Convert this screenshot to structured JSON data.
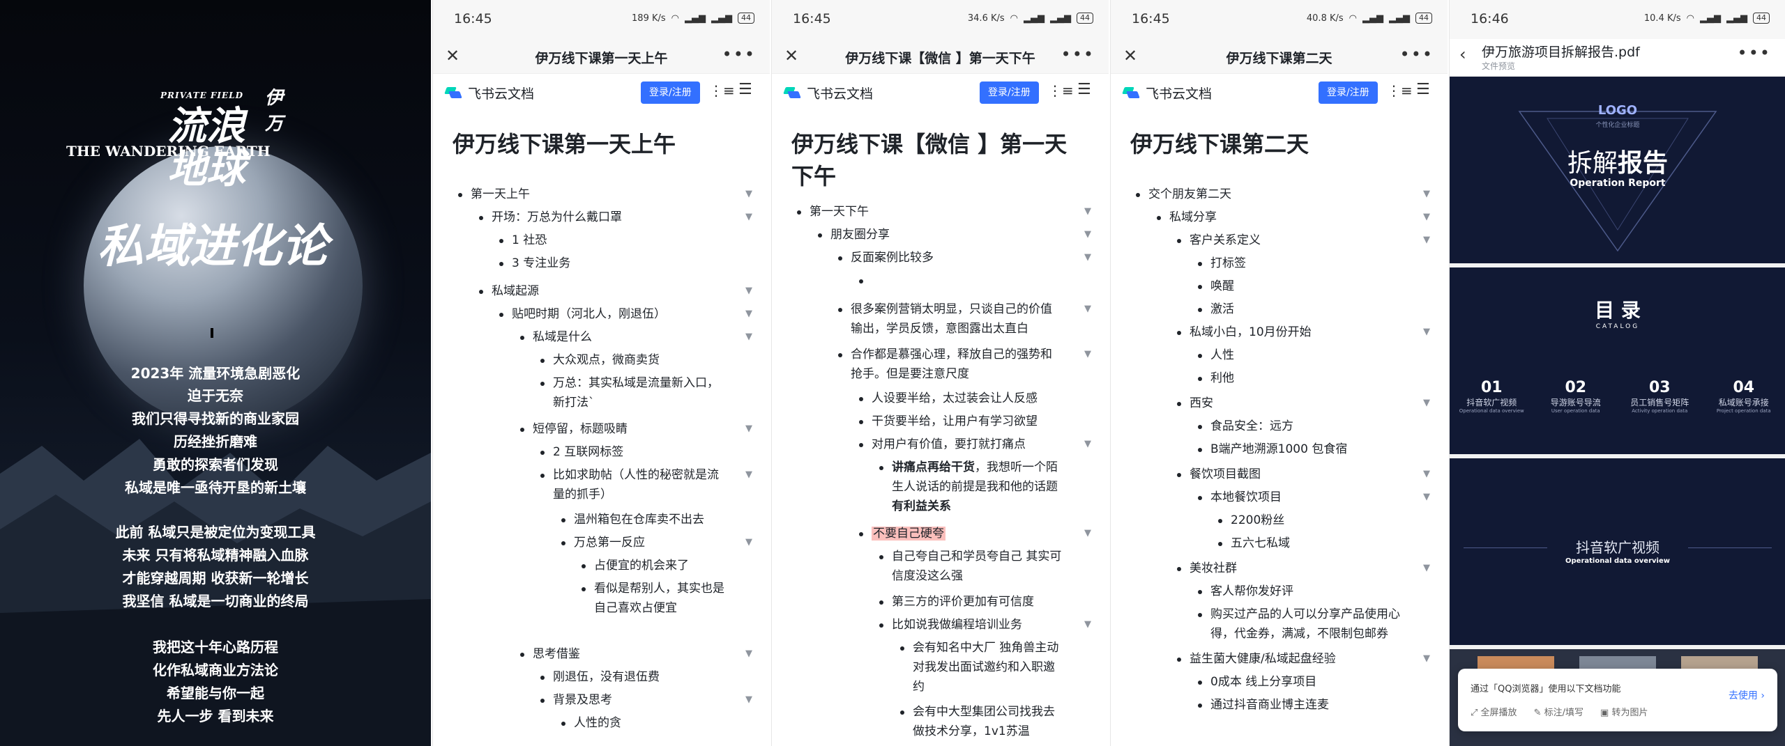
{
  "poster": {
    "en_top": "PRIVATE FIELD",
    "en_title": "THE WANDERING EARTH",
    "cn_title": "流浪地球",
    "brand": "伊万",
    "headline": "私域进化论",
    "lines": [
      "2023年 流量环境急剧恶化",
      "迫于无奈",
      "我们只得寻找新的商业家园",
      "历经挫折磨难",
      "勇敢的探索者们发现",
      "私域是唯一亟待开垦的新土壤",
      "此前 私域只是被定位为变现工具",
      "未来 只有将私域精神融入血脉",
      "才能穿越周期 收获新一轮增长",
      "我坚信 私域是一切商业的终局",
      "我把这十年心路历程",
      "化作私域商业方法论",
      "希望能与你一起",
      "先人一步 看到未来"
    ]
  },
  "common": {
    "brand": "飞书云文档",
    "login": "登录/注册"
  },
  "doc1": {
    "time": "16:45",
    "speed": "189 K/s",
    "battery": "44",
    "title": "伊万线下课第一天上午",
    "rows": [
      "第一天上午",
      "开场：万总为什么戴口罩",
      "1 社恐",
      "3 专注业务",
      "私域起源",
      "贴吧时期（河北人，刚退伍）",
      "私域是什么",
      "大众观点，微商卖货",
      "万总：其实私域是流量新入口，",
      "新打法`",
      "短停留，标题吸睛",
      "2 互联网标签",
      "比如求助帖（人性的秘密就是流",
      "量的抓手）",
      "温州箱包在仓库卖不出去",
      "万总第一反应",
      "占便宜的机会来了",
      "看似是帮别人，其实也是",
      "自己喜欢占便宜",
      "思考借鉴",
      "刚退伍，没有退伍费",
      "背景及思考",
      "人性的贪"
    ]
  },
  "doc2": {
    "time": "16:45",
    "speed": "34.6 K/s",
    "battery": "44",
    "title": "伊万线下课【微信 】第一天下午",
    "title_l1": "伊万线下课【微信 】第一天",
    "title_l2": "下午",
    "rows": [
      "第一天下午",
      "朋友圈分享",
      "反面案例比较多",
      "",
      "很多案例营销太明显，只谈自己的价值",
      "输出，学员反馈，意图露出太直白",
      "合作都是慕强心理，释放自己的强势和",
      "抢手。但是要注意尺度",
      "人设要半给，太过装会让人反感",
      "干货要半给，让用户有学习欲望",
      "对用户有价值，要打就打痛点",
      "讲痛点再给干货",
      "，我想听一个陌",
      "生人说话的前提是我和他的话题",
      "有利益关系",
      "不要自己硬夸",
      "自己夸自己和学员夸自己 其实可",
      "信度没这么强",
      "第三方的评价更加有可信度",
      "比如说我做编程培训业务",
      "会有知名中大厂 独角兽主动",
      "对我发出面试邀约和入职邀",
      "约",
      "会有中大型集团公司找我去",
      "做技术分享，1v1苏温"
    ]
  },
  "doc3": {
    "time": "16:45",
    "speed": "40.8 K/s",
    "battery": "44",
    "title": "伊万线下课第二天",
    "rows": [
      "交个朋友第二天",
      "私域分享",
      "客户关系定义",
      "打标签",
      "唤醒",
      "激活",
      "私域小白，10月份开始",
      "人性",
      "利他",
      "西安",
      "食品安全：远方",
      "B端产地溯源1000 包食宿",
      "餐饮项目截图",
      "本地餐饮项目",
      "2200粉丝",
      "五六七私域",
      "美妆社群",
      "客人帮你发好评",
      "购买过产品的人可以分享产品使用心",
      "得，代金券，满减，不限制包邮券",
      "益生菌大健康/私域起盘经验",
      "0成本 线上分享项目",
      "通过抖音商业博主连麦"
    ]
  },
  "pdf": {
    "time": "16:46",
    "speed": "10.4 K/s",
    "battery": "44",
    "file": "伊万旅游项目拆解报告.pdf",
    "sub": "文件预览",
    "slide1": {
      "logo": "LOGO",
      "logo_sub": "个性化企业标题",
      "title_a": "拆解",
      "title_b": "报告",
      "en": "Operation Report"
    },
    "slide2": {
      "title": "目 录",
      "en": "CATALOG",
      "items": [
        {
          "n": "01",
          "t": "抖音软广视频",
          "e": "Operational data overview"
        },
        {
          "n": "02",
          "t": "导游账号导流",
          "e": "User operation data"
        },
        {
          "n": "03",
          "t": "员工销售号矩阵",
          "e": "Activity operation data"
        },
        {
          "n": "04",
          "t": "私域账号承接",
          "e": "Project operation data"
        }
      ]
    },
    "slide3": {
      "title": "抖音软广视频",
      "en": "Operational data overview"
    },
    "toast": {
      "msg": "通过「QQ浏览器」使用以下文档功能",
      "go": "去使用 ›",
      "f1": "全屏播放",
      "f2": "标注/填写",
      "f3": "转为图片"
    }
  }
}
